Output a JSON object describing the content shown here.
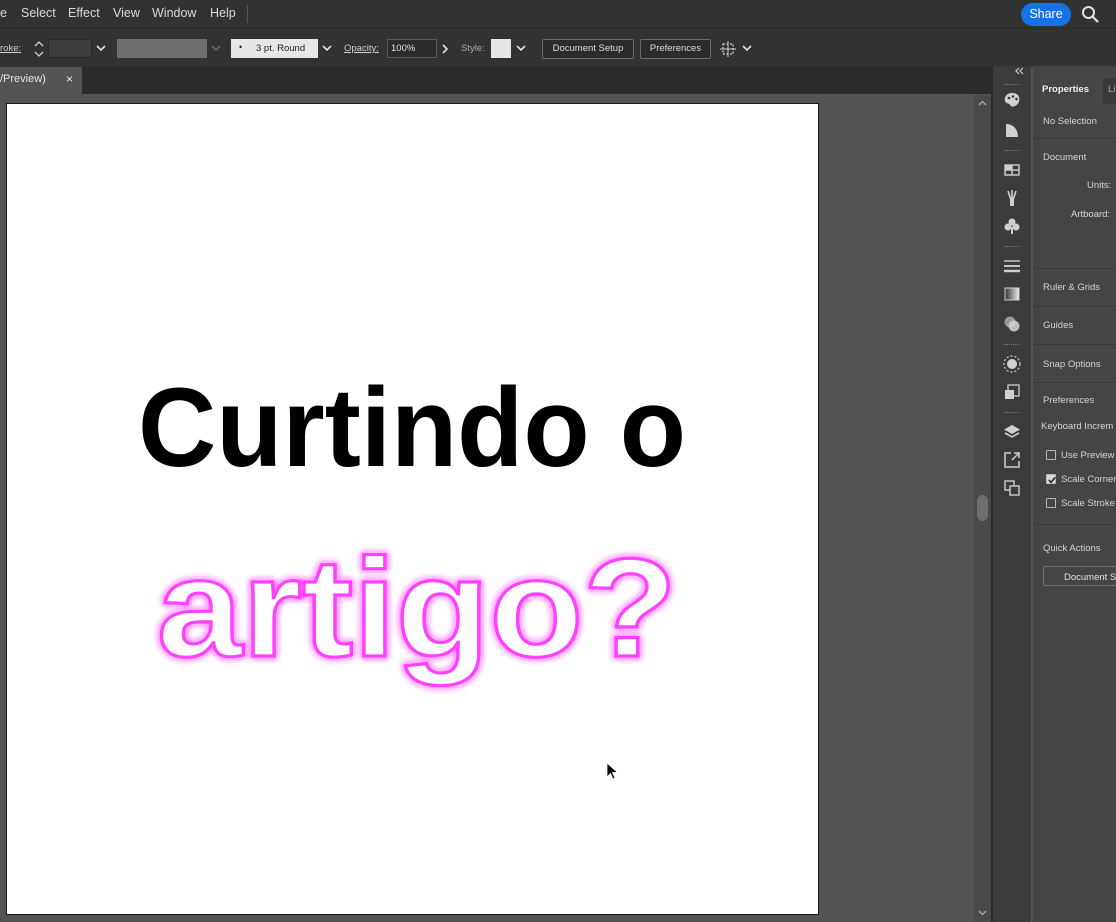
{
  "menubar": {
    "items": [
      "e",
      "Select",
      "Effect",
      "View",
      "Window",
      "Help"
    ],
    "share_label": "Share",
    "search_icon": "search-icon"
  },
  "controlbar": {
    "stroke_label": "roke:",
    "brush_value": "3 pt. Round",
    "opacity_label": "Opacity:",
    "opacity_value": "100%",
    "style_label": "Style:",
    "document_setup_label": "Document Setup",
    "preferences_label": "Preferences"
  },
  "tab": {
    "title": "/Preview)",
    "close_glyph": "×"
  },
  "artboard": {
    "line1": "Curtindo o",
    "line2": "artigo?",
    "line1_color": "#000000",
    "line2_outline_color": "#ff40ff"
  },
  "properties_panel": {
    "tab_properties": "Properties",
    "tab_layers": "Li",
    "no_selection": "No Selection",
    "document_heading": "Document",
    "units_label": "Units:",
    "artboard_label": "Artboard:",
    "ruler_grids": "Ruler & Grids",
    "guides": "Guides",
    "snap_options": "Snap Options",
    "preferences": "Preferences",
    "keyboard_increment": "Keyboard Increm",
    "use_preview": "Use Preview",
    "scale_corners": "Scale Corner",
    "scale_strokes": "Scale Stroke",
    "use_preview_checked": false,
    "scale_corners_checked": true,
    "scale_strokes_checked": false,
    "quick_actions": "Quick Actions",
    "document_setup_button": "Document S"
  },
  "icons": [
    "color-palette-icon",
    "color-guide-icon",
    "swatches-icon",
    "brushes-icon",
    "symbols-icon",
    "stroke-icon",
    "gradient-icon",
    "transparency-icon",
    "appearance-icon",
    "graphic-styles-icon",
    "layers-icon",
    "export-icon",
    "artboards-icon"
  ]
}
